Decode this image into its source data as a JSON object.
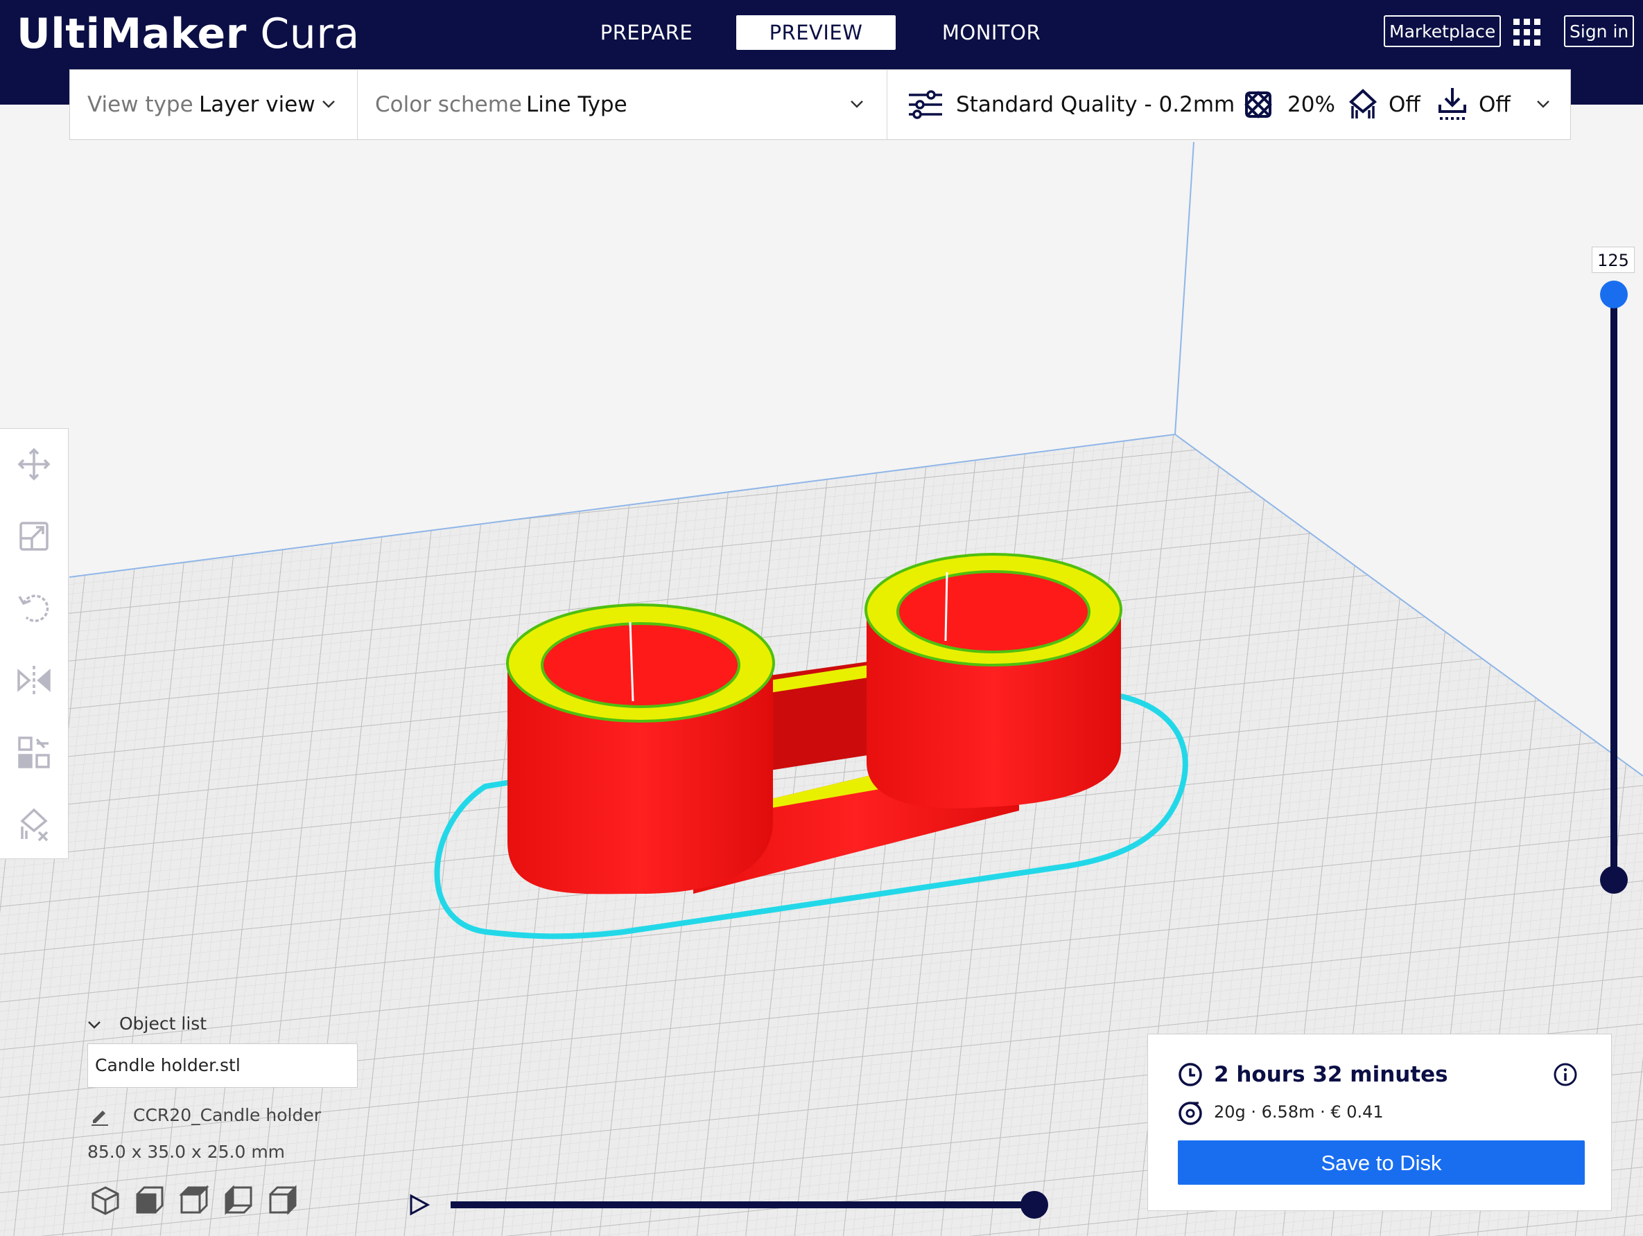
{
  "app": {
    "logo_bold": "UltiMaker",
    "logo_light": "Cura"
  },
  "stages": {
    "prepare": "PREPARE",
    "preview": "PREVIEW",
    "monitor": "MONITOR",
    "active": "PREVIEW"
  },
  "header": {
    "marketplace": "Marketplace",
    "sign_in": "Sign in"
  },
  "toolbar": {
    "view_type_label": "View type",
    "view_type_value": "Layer view",
    "color_scheme_label": "Color scheme",
    "color_scheme_value": "Line Type",
    "quality": "Standard Quality - 0.2mm",
    "infill": "20%",
    "support": "Off",
    "adhesion": "Off"
  },
  "layer_slider": {
    "current_layer": "125"
  },
  "object_list": {
    "header": "Object list",
    "file": "Candle holder.stl",
    "object_name": "CCR20_Candle holder",
    "dimensions": "85.0 x 35.0 x 25.0 mm"
  },
  "print_summary": {
    "time": "2 hours 32 minutes",
    "material": "20g · 6.58m · € 0.41",
    "save_label": "Save to Disk"
  },
  "colors": {
    "header_bg": "#0b0f45",
    "accent_blue": "#196ef0",
    "wall_red": "#ff1a1a",
    "top_yellow": "#e8f000",
    "skirt_cyan": "#22d8e8"
  },
  "icons": {
    "quality": "sliders-icon",
    "infill": "infill-icon",
    "support": "support-icon",
    "adhesion": "adhesion-icon",
    "time": "clock-icon",
    "material": "spool-icon",
    "info": "info-icon",
    "play": "play-icon"
  }
}
